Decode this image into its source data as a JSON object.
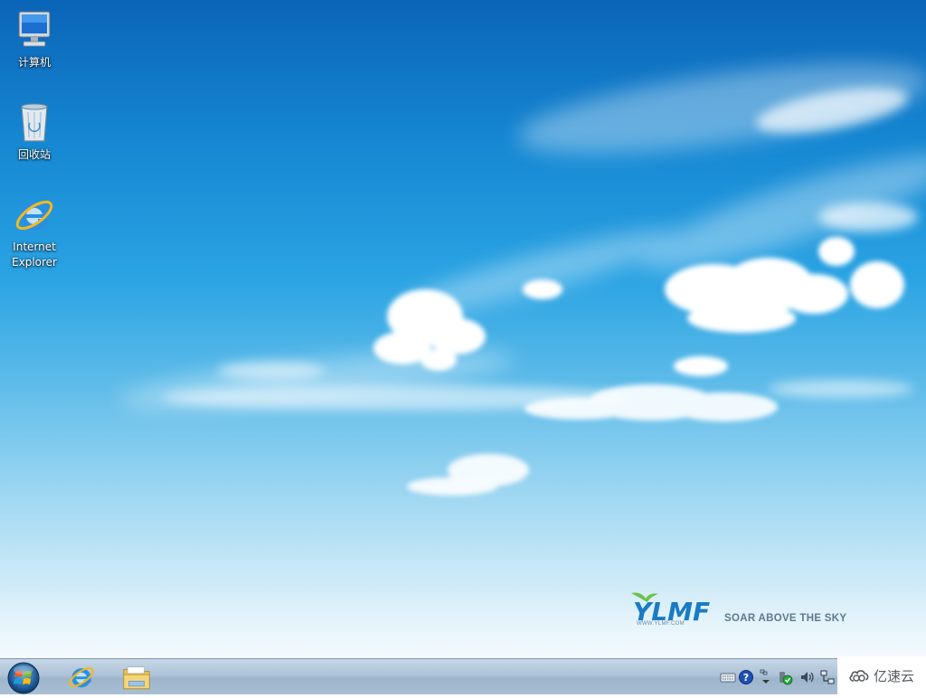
{
  "desktop": {
    "icons": [
      {
        "label": "计算机",
        "icon": "computer-icon"
      },
      {
        "label": "回收站",
        "icon": "recycle-bin-icon"
      },
      {
        "label": "Internet\nExplorer",
        "icon": "internet-explorer-icon"
      }
    ]
  },
  "wallpaper": {
    "brand_logo": "YLMF",
    "brand_tagline": "SOAR ABOVE THE SKY",
    "brand_url": "WWW.YLMF.COM"
  },
  "taskbar": {
    "start_icon": "windows-start-icon",
    "pinned": [
      {
        "name": "internet-explorer",
        "icon": "internet-explorer-icon"
      },
      {
        "name": "windows-explorer",
        "icon": "folder-library-icon"
      }
    ],
    "tray_icons": [
      "keyboard-icon",
      "help-icon",
      "show-hidden-icons-chevron",
      "action-center-icon",
      "volume-icon",
      "network-icon"
    ]
  },
  "watermark": {
    "text": "亿速云",
    "icon": "cloud-logo-icon"
  },
  "colors": {
    "sky_top": "#0a64b8",
    "sky_bottom": "#f4fafd",
    "taskbar": "#aec3d8",
    "brand_green": "#6cc24a",
    "brand_blue": "#1a7bc4"
  }
}
